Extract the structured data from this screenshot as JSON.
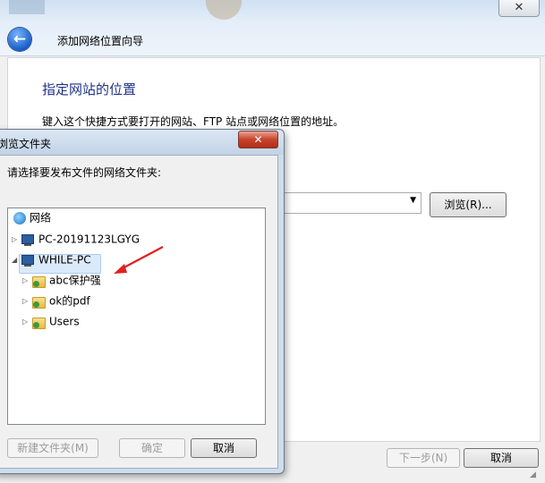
{
  "wizard": {
    "title": "添加网络位置向导",
    "heading": "指定网站的位置",
    "description": "键入这个快捷方式要打开的网站、FTP 站点或网络位置的地址。",
    "address_value": "",
    "browse_label": "浏览(R)...",
    "next_label": "下一步(N)",
    "cancel_label": "取消"
  },
  "dialog": {
    "title": "浏览文件夹",
    "prompt": "请选择要发布文件的网络文件夹:",
    "tree": {
      "root": "网络",
      "computers": [
        {
          "label": "PC-20191123LGYG",
          "expanded": false
        },
        {
          "label": "WHILE-PC",
          "expanded": true,
          "selected": true
        }
      ],
      "folders": [
        "abc保护强",
        "ok的pdf",
        "Users"
      ]
    },
    "new_folder_label": "新建文件夹(M)",
    "ok_label": "确定",
    "cancel_label": "取消"
  },
  "annotation": {
    "arrow_color": "#e02020"
  },
  "colors": {
    "heading": "#1e3287",
    "selection": "#dbeafa"
  }
}
